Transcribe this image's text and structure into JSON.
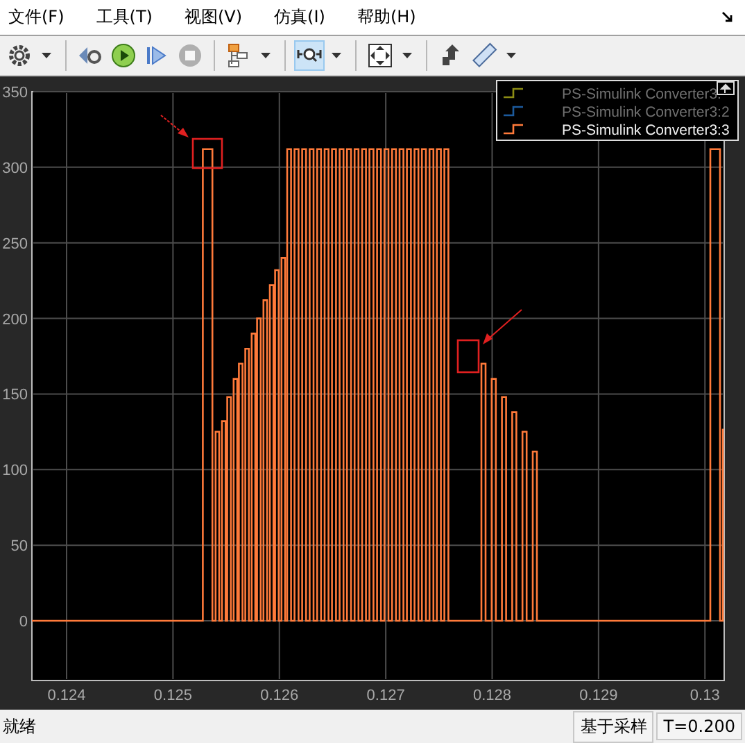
{
  "menu": [
    "文件(F)",
    "工具(T)",
    "视图(V)",
    "仿真(I)",
    "帮助(H)"
  ],
  "toolbar": [
    {
      "kind": "settings",
      "caret": true,
      "selected": false,
      "disabled": false
    },
    {
      "kind": "separator"
    },
    {
      "kind": "step-back",
      "caret": false,
      "selected": false,
      "disabled": false
    },
    {
      "kind": "run",
      "caret": false,
      "selected": false,
      "disabled": false
    },
    {
      "kind": "step",
      "caret": false,
      "selected": false,
      "disabled": false
    },
    {
      "kind": "stop",
      "caret": false,
      "selected": false,
      "disabled": true
    },
    {
      "kind": "separator"
    },
    {
      "kind": "blocks",
      "caret": true,
      "selected": false,
      "disabled": false
    },
    {
      "kind": "separator"
    },
    {
      "kind": "zoom",
      "caret": true,
      "selected": true,
      "disabled": false
    },
    {
      "kind": "separator"
    },
    {
      "kind": "fit",
      "caret": true,
      "selected": false,
      "disabled": false
    },
    {
      "kind": "separator"
    },
    {
      "kind": "highlight",
      "caret": false,
      "selected": false,
      "disabled": false
    },
    {
      "kind": "measure",
      "caret": true,
      "selected": false,
      "disabled": false
    }
  ],
  "plot": {
    "legend": [
      {
        "label": "PS-Simulink Converter3:",
        "color": "#8c8c14",
        "disabled": true
      },
      {
        "label": "PS-Simulink Converter3:2",
        "color": "#1c5a9c",
        "disabled": true
      },
      {
        "label": "PS-Simulink Converter3:3",
        "color": "#ff7a3a",
        "disabled": false
      }
    ],
    "chart_data": {
      "type": "line",
      "grid": true,
      "xlim": [
        0.123674,
        0.130181
      ],
      "ylim": [
        -39.5,
        350
      ],
      "xticks": [
        {
          "value": 0.124,
          "label": "0.124"
        },
        {
          "value": 0.125,
          "label": "0.125"
        },
        {
          "value": 0.126,
          "label": "0.126"
        },
        {
          "value": 0.127,
          "label": "0.127"
        },
        {
          "value": 0.128,
          "label": "0.128"
        },
        {
          "value": 0.129,
          "label": "0.129"
        },
        {
          "value": 0.13,
          "label": "0.13"
        }
      ],
      "yticks": [
        350,
        300,
        250,
        200,
        150,
        100,
        50,
        0
      ],
      "x": [
        0.123674,
        0.12528,
        0.12528,
        0.12537,
        0.12537,
        0.1254,
        0.1254,
        0.125434,
        0.125434,
        0.12546,
        0.12546,
        0.125494,
        0.125494,
        0.12551,
        0.12551,
        0.125544,
        0.125544,
        0.12557,
        0.12557,
        0.125604,
        0.125604,
        0.12562,
        0.12562,
        0.125654,
        0.125654,
        0.12568,
        0.12568,
        0.125714,
        0.125714,
        0.12574,
        0.12574,
        0.125774,
        0.125774,
        0.12579,
        0.12579,
        0.125824,
        0.125824,
        0.12585,
        0.12585,
        0.125884,
        0.125884,
        0.12591,
        0.12591,
        0.125944,
        0.125944,
        0.12596,
        0.12596,
        0.125994,
        0.125994,
        0.12602,
        0.12602,
        0.126054,
        0.126054,
        0.126073,
        0.126073,
        0.12611,
        0.12611,
        0.126143,
        0.126143,
        0.12618,
        0.12618,
        0.126214,
        0.126214,
        0.126251,
        0.126251,
        0.126284,
        0.126284,
        0.126321,
        0.126321,
        0.126355,
        0.126355,
        0.126392,
        0.126392,
        0.126425,
        0.126425,
        0.126462,
        0.126462,
        0.126495,
        0.126495,
        0.126532,
        0.126532,
        0.126566,
        0.126566,
        0.126603,
        0.126603,
        0.126636,
        0.126636,
        0.126673,
        0.126673,
        0.126707,
        0.126707,
        0.126744,
        0.126744,
        0.126777,
        0.126777,
        0.126814,
        0.126814,
        0.126847,
        0.126847,
        0.126884,
        0.126884,
        0.126918,
        0.126918,
        0.126955,
        0.126955,
        0.126988,
        0.126988,
        0.127025,
        0.127025,
        0.127059,
        0.127059,
        0.127096,
        0.127096,
        0.127129,
        0.127129,
        0.127166,
        0.127166,
        0.127199,
        0.127199,
        0.127236,
        0.127236,
        0.12727,
        0.12727,
        0.127307,
        0.127307,
        0.12734,
        0.12734,
        0.127377,
        0.127377,
        0.127411,
        0.127411,
        0.127448,
        0.127448,
        0.127481,
        0.127481,
        0.127518,
        0.127518,
        0.127551,
        0.127551,
        0.127588,
        0.127588,
        0.127899,
        0.127899,
        0.127938,
        0.127938,
        0.127996,
        0.127996,
        0.128035,
        0.128035,
        0.128092,
        0.128092,
        0.128131,
        0.128131,
        0.128189,
        0.128189,
        0.128228,
        0.128228,
        0.128285,
        0.128285,
        0.128324,
        0.128324,
        0.128382,
        0.128382,
        0.128421,
        0.128421,
        0.130051,
        0.130051,
        0.130142,
        0.130142,
        0.130168,
        0.130168
      ],
      "series": [
        {
          "color": "#ff7a3a",
          "values": [
            0,
            0,
            312,
            312,
            0,
            0,
            125,
            125,
            0,
            0,
            132,
            132,
            0,
            0,
            148,
            148,
            0,
            0,
            160,
            160,
            0,
            0,
            170,
            170,
            0,
            0,
            180,
            180,
            0,
            0,
            190,
            190,
            0,
            0,
            200,
            200,
            0,
            0,
            212,
            212,
            0,
            0,
            222,
            222,
            0,
            0,
            232,
            232,
            0,
            0,
            240,
            240,
            0,
            0,
            312,
            312,
            0,
            0,
            312,
            312,
            0,
            0,
            312,
            312,
            0,
            0,
            312,
            312,
            0,
            0,
            312,
            312,
            0,
            0,
            312,
            312,
            0,
            0,
            312,
            312,
            0,
            0,
            312,
            312,
            0,
            0,
            312,
            312,
            0,
            0,
            312,
            312,
            0,
            0,
            312,
            312,
            0,
            0,
            312,
            312,
            0,
            0,
            312,
            312,
            0,
            0,
            312,
            312,
            0,
            0,
            312,
            312,
            0,
            0,
            312,
            312,
            0,
            0,
            312,
            312,
            0,
            0,
            312,
            312,
            0,
            0,
            312,
            312,
            0,
            0,
            312,
            312,
            0,
            0,
            312,
            312,
            0,
            0,
            312,
            312,
            0,
            0,
            170,
            170,
            0,
            0,
            160,
            160,
            0,
            0,
            148,
            148,
            0,
            0,
            138,
            138,
            0,
            0,
            125,
            125,
            0,
            0,
            112,
            112,
            0,
            0,
            312,
            312,
            0,
            0,
            127
          ]
        }
      ]
    }
  },
  "status_bar": {
    "state": "就绪",
    "mode": "基于采样",
    "time": "T=0.200"
  }
}
